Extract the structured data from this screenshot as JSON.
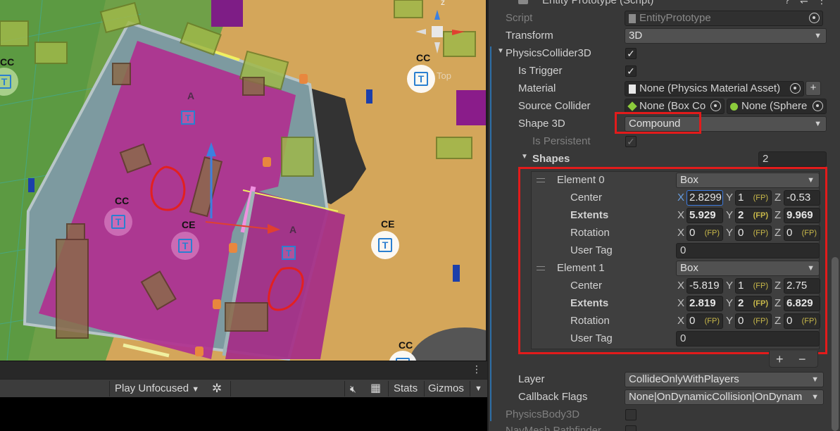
{
  "scene": {
    "labels": {
      "cc_top_left": "CC",
      "cc_top_right": "CC",
      "top_ghost": "Top",
      "a_upper": "A",
      "cc_left": "CC",
      "ce_mid": "CE",
      "a_right": "A",
      "ce_right": "CE",
      "cc_bottom": "CC",
      "gizmo_z": "z"
    },
    "badge_letter": "T"
  },
  "scene_menu_icon": "kebab-menu-icon",
  "game_toolbar": {
    "play_mode": "Play Unfocused",
    "stats_label": "Stats",
    "gizmos_label": "Gizmos"
  },
  "inspector": {
    "header_title": "Entity Prototype (Script)",
    "script": {
      "label": "Script",
      "value": "EntityPrototype"
    },
    "transform": {
      "label": "Transform",
      "value": "3D"
    },
    "physics_collider": {
      "label": "PhysicsCollider3D",
      "is_trigger_label": "Is Trigger",
      "material_label": "Material",
      "material_value": "None (Physics Material Asset)",
      "source_collider_label": "Source Collider",
      "source_collider_a": "None (Box Co",
      "source_collider_b": "None (Sphere",
      "shape_label": "Shape 3D",
      "shape_value": "Compound",
      "is_persistent_label": "Is Persistent",
      "shapes_label": "Shapes",
      "shapes_count": "2"
    },
    "elements": [
      {
        "label": "Element 0",
        "type": "Box",
        "center_label": "Center",
        "center": {
          "x": "2.8299",
          "y": "1",
          "z": "-0.53"
        },
        "extents_label": "Extents",
        "extents": {
          "x": "5.929",
          "y": "2",
          "z": "9.969"
        },
        "rotation_label": "Rotation",
        "rotation": {
          "x": "0",
          "y": "0",
          "z": "0"
        },
        "user_tag_label": "User Tag",
        "user_tag": "0"
      },
      {
        "label": "Element 1",
        "type": "Box",
        "center_label": "Center",
        "center": {
          "x": "-5.819",
          "y": "1",
          "z": "2.75"
        },
        "extents_label": "Extents",
        "extents": {
          "x": "2.819",
          "y": "2",
          "z": "6.829"
        },
        "rotation_label": "Rotation",
        "rotation": {
          "x": "0",
          "y": "0",
          "z": "0"
        },
        "user_tag_label": "User Tag",
        "user_tag": "0"
      }
    ],
    "axis": {
      "x": "X",
      "y": "Y",
      "z": "Z"
    },
    "fp_tag": "(FP)",
    "add_button": "+",
    "remove_button": "−",
    "layer_label": "Layer",
    "layer_value": "CollideOnlyWithPlayers",
    "callback_label": "Callback Flags",
    "callback_value": "None|OnDynamicCollision|OnDynam",
    "physics_body_label": "PhysicsBody3D",
    "navmesh_label": "NavMesh Pathfinder"
  }
}
